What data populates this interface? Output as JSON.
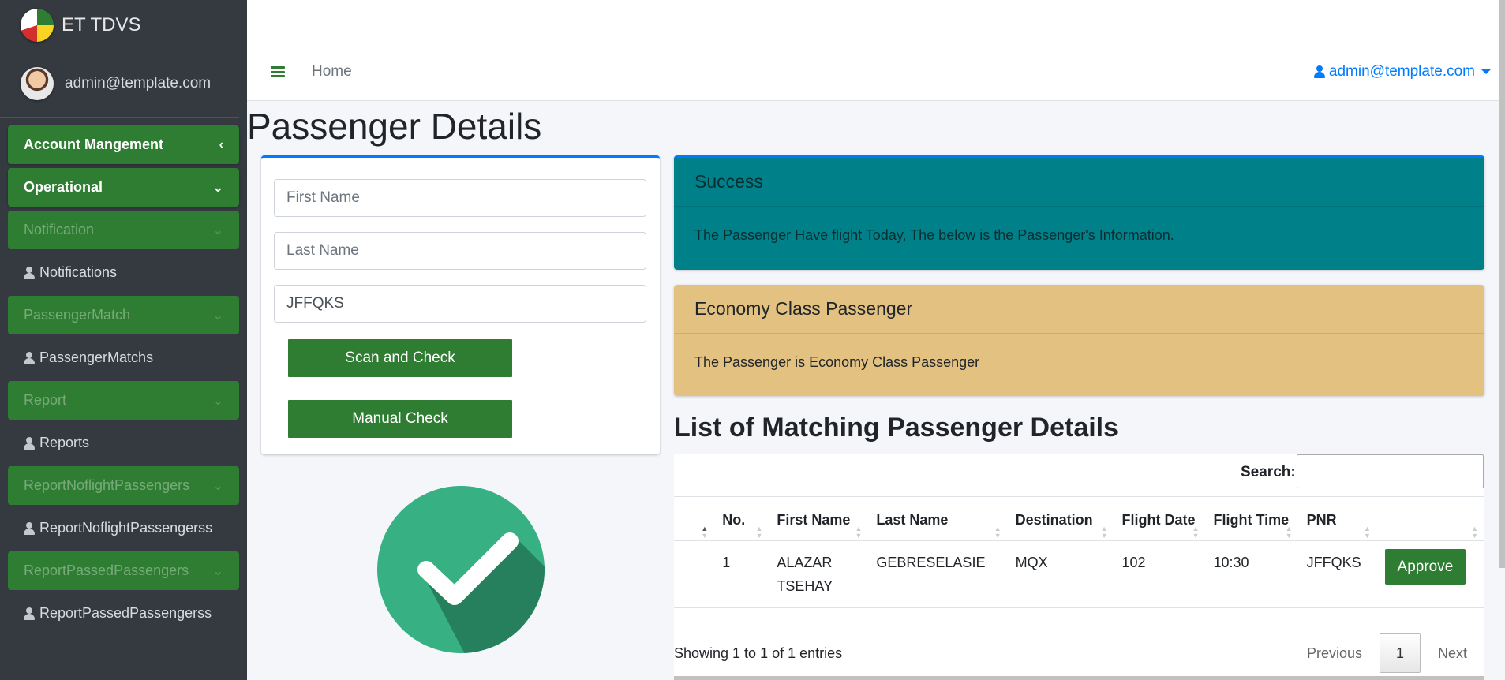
{
  "brand": {
    "title": "ET TDVS"
  },
  "user": {
    "email": "admin@template.com"
  },
  "sidebar": {
    "items": [
      {
        "label": "Account Mangement",
        "type": "active",
        "chevron": "chevron-left-icon"
      },
      {
        "label": "Operational",
        "type": "active",
        "chevron": "chevron-down-icon"
      },
      {
        "label": "Notification",
        "type": "dim",
        "chevron": "chevron-down-icon"
      },
      {
        "label": "Notifications",
        "type": "sub"
      },
      {
        "label": "PassengerMatch",
        "type": "dim",
        "chevron": "chevron-down-icon"
      },
      {
        "label": "PassengerMatchs",
        "type": "sub"
      },
      {
        "label": "Report",
        "type": "dim",
        "chevron": "chevron-down-icon"
      },
      {
        "label": "Reports",
        "type": "sub"
      },
      {
        "label": "ReportNoflightPassengers",
        "type": "dim",
        "chevron": "chevron-down-icon"
      },
      {
        "label": "ReportNoflightPassengerss",
        "type": "sub"
      },
      {
        "label": "ReportPassedPassengers",
        "type": "dim",
        "chevron": "chevron-down-icon"
      },
      {
        "label": "ReportPassedPassengerss",
        "type": "sub"
      }
    ]
  },
  "navbar": {
    "home": "Home",
    "user": "admin@template.com"
  },
  "page": {
    "title": "Passenger Details"
  },
  "form": {
    "first_name_placeholder": "First Name",
    "last_name_placeholder": "Last Name",
    "pnr_value": "JFFQKS",
    "scan_button": "Scan and Check",
    "manual_button": "Manual Check"
  },
  "alerts": {
    "success_title": "Success",
    "success_body": "The Passenger Have flight Today, The below is the Passenger's Information.",
    "class_title": "Economy Class Passenger",
    "class_body": "The Passenger is Economy Class Passenger"
  },
  "list": {
    "title": "List of Matching Passenger Details",
    "search_label": "Search:",
    "columns": [
      "",
      "No.",
      "First Name",
      "Last Name",
      "Destination",
      "Flight Date",
      "Flight Time",
      "PNR",
      ""
    ],
    "rows": [
      {
        "no": "1",
        "first": "ALAZAR TSEHAY",
        "last": "GEBRESELASIE",
        "dest": "MQX",
        "date": "102",
        "time": "10:30",
        "pnr": "JFFQKS",
        "action": "Approve"
      }
    ],
    "info": "Showing 1 to 1 of 1 entries",
    "prev": "Previous",
    "page": "1",
    "next": "Next"
  },
  "colors": {
    "sidebar": "#343a40",
    "green": "#2e7d32",
    "success": "#00818a",
    "warning": "#e3c281",
    "link": "#007bff"
  }
}
